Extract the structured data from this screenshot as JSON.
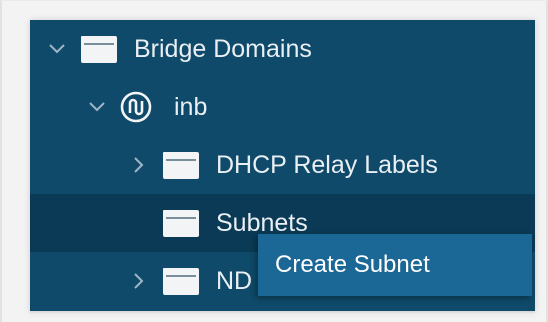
{
  "tree": {
    "items": [
      {
        "label": "Bridge Domains",
        "icon": "folder-icon",
        "expanded": true
      },
      {
        "label": "inb",
        "icon": "bridge-domain-icon",
        "expanded": true
      },
      {
        "label": "DHCP Relay Labels",
        "icon": "folder-icon",
        "expanded": false
      },
      {
        "label": "Subnets",
        "icon": "folder-icon",
        "selected": true
      },
      {
        "label": "ND",
        "icon": "folder-icon",
        "expanded": false
      }
    ]
  },
  "context_menu": {
    "items": [
      {
        "label": "Create Subnet"
      }
    ]
  },
  "colors": {
    "tree_background": "#0f4a6a",
    "selected_row": "#0a3a55",
    "menu_background": "#1b6795",
    "text": "#e9eff3"
  }
}
